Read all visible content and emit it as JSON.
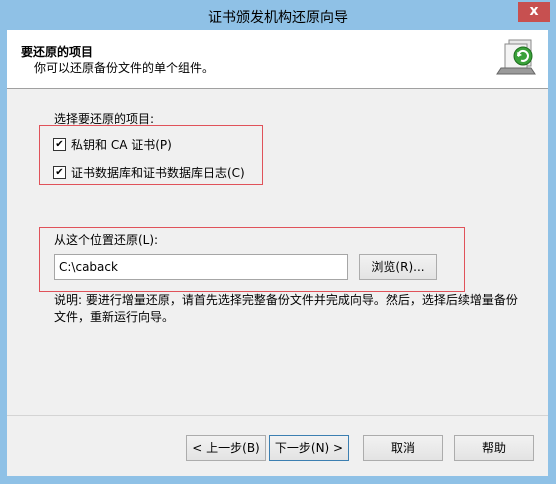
{
  "window": {
    "title": "证书颁发机构还原向导",
    "close_glyph": "x"
  },
  "header": {
    "title": "要还原的项目",
    "subtitle": "你可以还原备份文件的单个组件。",
    "icon": "backup-restore-icon"
  },
  "items_section": {
    "label": "选择要还原的项目:",
    "checkboxes": [
      {
        "label": "私钥和 CA 证书(P)",
        "checked": true,
        "mark": "✔"
      },
      {
        "label": "证书数据库和证书数据库日志(C)",
        "checked": true,
        "mark": "✔"
      }
    ]
  },
  "location_section": {
    "label": "从这个位置还原(L):",
    "path_value": "C:\\caback",
    "browse_label": "浏览(R)..."
  },
  "note": "说明: 要进行增量还原，请首先选择完整备份文件并完成向导。然后，选择后续增量备份文件，重新运行向导。",
  "footer": {
    "back_label": "< 上一步(B)",
    "next_label": "下一步(N) >",
    "cancel_label": "取消",
    "help_label": "帮助"
  },
  "colors": {
    "titlebar": "#8fc1e6",
    "highlight_box": "#e0525a"
  }
}
